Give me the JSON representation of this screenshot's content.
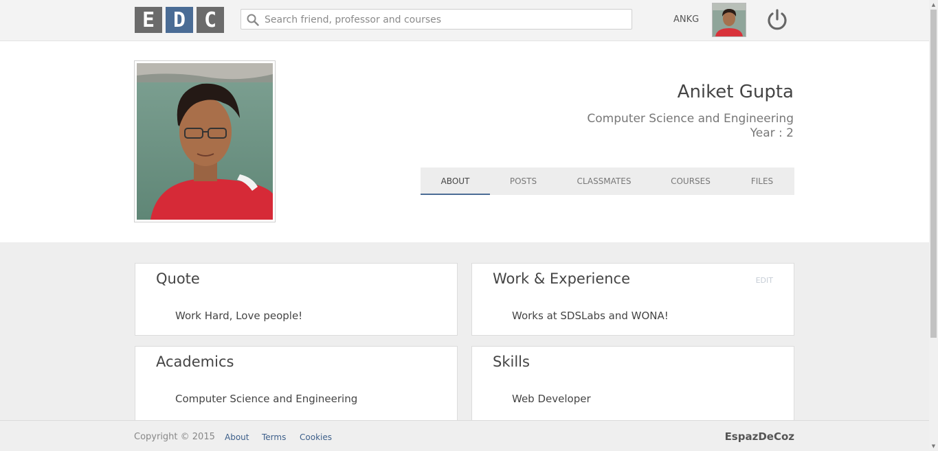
{
  "header": {
    "logo": [
      "E",
      "D",
      "C"
    ],
    "search_placeholder": "Search friend, professor and courses",
    "username": "ANKG"
  },
  "profile": {
    "name": "Aniket Gupta",
    "department": "Computer Science and Engineering",
    "year": "Year : 2",
    "tabs": [
      "ABOUT",
      "POSTS",
      "CLASSMATES",
      "COURSES",
      "FILES"
    ],
    "active_tab": "ABOUT"
  },
  "cards": {
    "quote": {
      "title": "Quote",
      "text": "Work Hard, Love people!"
    },
    "work": {
      "title": "Work & Experience",
      "edit": "EDIT",
      "text": "Works at SDSLabs and WONA!"
    },
    "academics": {
      "title": "Academics",
      "text": "Computer Science and Engineering"
    },
    "skills": {
      "title": "Skills",
      "text": "Web Developer"
    }
  },
  "footer": {
    "copyright": "Copyright © 2015",
    "links": [
      "About",
      "Terms",
      "Cookies"
    ],
    "brand": "EspazDeCoz"
  },
  "colors": {
    "accent": "#4a6c95",
    "logo_gray": "#6b6b6b",
    "link": "#3d5f8a",
    "page_bg": "#eeeeee"
  },
  "icons": {
    "search": "search-icon",
    "power": "power-icon"
  }
}
